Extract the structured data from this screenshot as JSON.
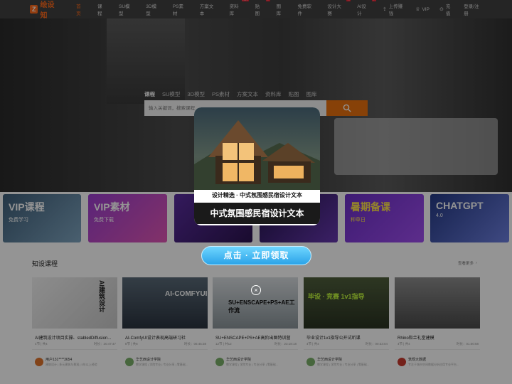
{
  "nav": {
    "logo": "绘设知",
    "items": [
      {
        "label": "首页",
        "active": true,
        "badge": ""
      },
      {
        "label": "课程",
        "active": false,
        "badge": ""
      },
      {
        "label": "SU模型",
        "active": false,
        "badge": ""
      },
      {
        "label": "3D模型",
        "active": false,
        "badge": ""
      },
      {
        "label": "PS素材",
        "active": false,
        "badge": ""
      },
      {
        "label": "方案文本",
        "active": false,
        "badge": ""
      },
      {
        "label": "资料库",
        "active": false,
        "badge": "免费"
      },
      {
        "label": "贴图",
        "active": false,
        "badge": "新"
      },
      {
        "label": "图库",
        "active": false,
        "badge": ""
      },
      {
        "label": "免费软件",
        "active": false,
        "badge": ""
      },
      {
        "label": "设计大赛",
        "active": false,
        "badge": "新"
      },
      {
        "label": "AI设计",
        "active": false,
        "badge": "新"
      }
    ],
    "right": {
      "upload": "上传赚钱",
      "vip": "VIP",
      "recharge": "充值",
      "login": "登录/注册"
    }
  },
  "hero": {
    "search_tabs": [
      "课程",
      "SU模型",
      "3D模型",
      "PS素材",
      "方案文本",
      "资料库",
      "贴图",
      "图库"
    ],
    "search_placeholder": "输入关键词，搜索课程"
  },
  "banners": [
    {
      "title": "VIP课程",
      "subtitle": "免费学习"
    },
    {
      "title": "VIP素材",
      "subtitle": "免费下载"
    },
    {
      "title": "",
      "subtitle": ""
    },
    {
      "title": "",
      "subtitle": ""
    },
    {
      "title": "暑期备课",
      "subtitle": "种草日"
    },
    {
      "title": "CHATGPT",
      "subtitle": "4.0"
    }
  ],
  "section": {
    "title": "知设课程",
    "more": "查看更多"
  },
  "courses": [
    {
      "title": "AI建筑设计项目实操、stabledDiffusion...",
      "lessons": "4节 | 共4",
      "duration": "时长：20:47:47",
      "thumb_text": "AI建筑设计",
      "author": "用户131****3654",
      "author_desc": "建筑设计 | 多元建筑与景观 | 5年以上经验",
      "avatar_color": "#e0742b"
    },
    {
      "title": "AI-ComfyUI设计表现高端研习社",
      "lessons": "8节 | 共8",
      "duration": "时长：06:45:38",
      "thumb_text": "AI-COMFYUI",
      "author": "华艺西设计学院",
      "author_desc": "教学课程 | 学院专业 | 专业分享 | 零基础...",
      "avatar_color": "#7ab06a"
    },
    {
      "title": "SU+ENSCAPE+PS+AE高阶出图特训营",
      "lessons": "12节 | 共12",
      "duration": "时长：23:18:18",
      "thumb_text": "SU+ENSCAPE+PS+AE工作流",
      "author": "华艺西设计学院",
      "author_desc": "教学课程 | 学院专业 | 专业分享 | 零基础...",
      "avatar_color": "#7ab06a"
    },
    {
      "title": "毕业设计1v1指导公开试听课",
      "lessons": "4节 | 共4",
      "duration": "时长：00:33:04",
      "thumb_text": "毕设 · 竞赛 1v1指导",
      "author": "华艺西设计学院",
      "author_desc": "教学课程 | 学院专业 | 专业分享 | 零基础...",
      "avatar_color": "#7ab06a"
    },
    {
      "title": "Rhino和兰礼堂建模",
      "lessons": "4节 | 共4",
      "duration": "时长：01:00:58",
      "thumb_text": "",
      "author": "筑规大数据",
      "author_desc": "专注于城市空间数据分析应用专业平台...",
      "avatar_color": "#c83a2e"
    }
  ],
  "popup": {
    "caption1": "设计精选 · 中式氛围感民宿设计文本",
    "caption2": "中式氛围感民宿设计文本",
    "button": "点击 · 立即领取",
    "close": "×"
  },
  "colors": {
    "accent": "#e8700f",
    "button": "#2ba3e8"
  }
}
